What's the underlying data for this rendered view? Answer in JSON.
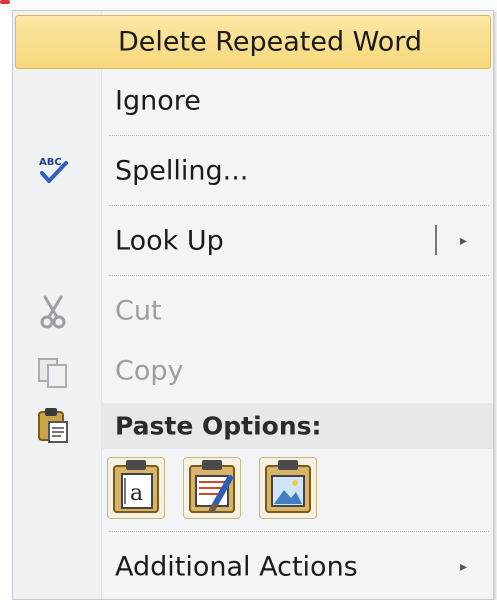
{
  "menu": {
    "items": [
      {
        "label": "Delete Repeated Word",
        "state": "highlighted"
      },
      {
        "label": "Ignore",
        "state": "enabled"
      },
      {
        "label": "Spelling...",
        "state": "enabled",
        "icon": "spellcheck-icon"
      },
      {
        "label": "Look Up",
        "state": "enabled",
        "has_submenu": true
      },
      {
        "label": "Cut",
        "state": "disabled",
        "icon": "scissors-icon"
      },
      {
        "label": "Copy",
        "state": "disabled",
        "icon": "copy-icon"
      }
    ],
    "paste_section": {
      "label": "Paste Options:",
      "icon": "paste-icon",
      "options": [
        {
          "icon": "keep-text-only-icon"
        },
        {
          "icon": "merge-formatting-icon"
        },
        {
          "icon": "picture-icon"
        }
      ]
    },
    "additional_actions": {
      "label": "Additional Actions",
      "has_submenu": true
    }
  },
  "glyphs": {
    "arrow": "▸"
  },
  "colors": {
    "highlight_top": "#fbe8a5",
    "highlight_bottom": "#f6d77a",
    "highlight_border": "#d9b85a",
    "disabled_text": "#9aa0a6"
  }
}
